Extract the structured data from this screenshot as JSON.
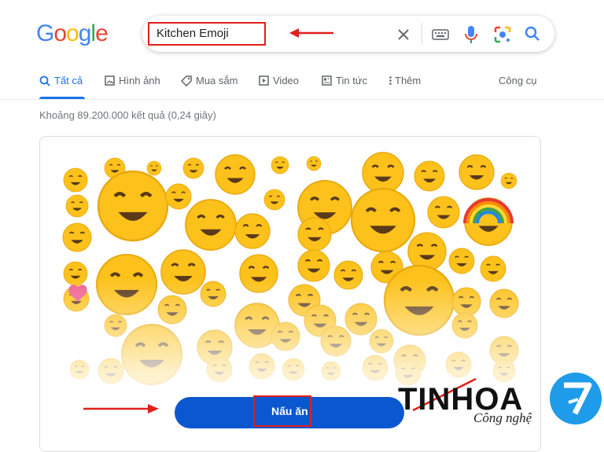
{
  "logo": {
    "text": "Google",
    "letters": [
      {
        "ch": "G",
        "color": "#4285F4"
      },
      {
        "ch": "o",
        "color": "#EA4335"
      },
      {
        "ch": "o",
        "color": "#FBBC05"
      },
      {
        "ch": "g",
        "color": "#4285F4"
      },
      {
        "ch": "l",
        "color": "#34A853"
      },
      {
        "ch": "e",
        "color": "#EA4335"
      }
    ]
  },
  "search": {
    "query": "Kitchen Emoji",
    "icons": [
      "clear-icon",
      "keyboard-icon",
      "microphone-icon",
      "lens-icon",
      "search-icon"
    ]
  },
  "tabs": [
    {
      "label": "Tất cả",
      "icon": "search-icon",
      "active": true
    },
    {
      "label": "Hình ảnh",
      "icon": "image-icon",
      "active": false
    },
    {
      "label": "Mua sắm",
      "icon": "tag-icon",
      "active": false
    },
    {
      "label": "Video",
      "icon": "play-icon",
      "active": false
    },
    {
      "label": "Tin tức",
      "icon": "news-icon",
      "active": false
    },
    {
      "label": "Thêm",
      "icon": "more-vert-icon",
      "active": false
    }
  ],
  "tools_label": "Công cụ",
  "stats": "Khoảng 89.200.000 kết quả (0,24 giây)",
  "emoji_kitchen": {
    "cook_button_label": "Nấu ăn"
  },
  "watermark": {
    "brand": "TINHOA",
    "sub": "Công nghệ"
  },
  "colors": {
    "accent": "#1a73e8",
    "button": "#0b57d0",
    "annotation": "#e0201b",
    "emoji": "#fcc21b"
  }
}
